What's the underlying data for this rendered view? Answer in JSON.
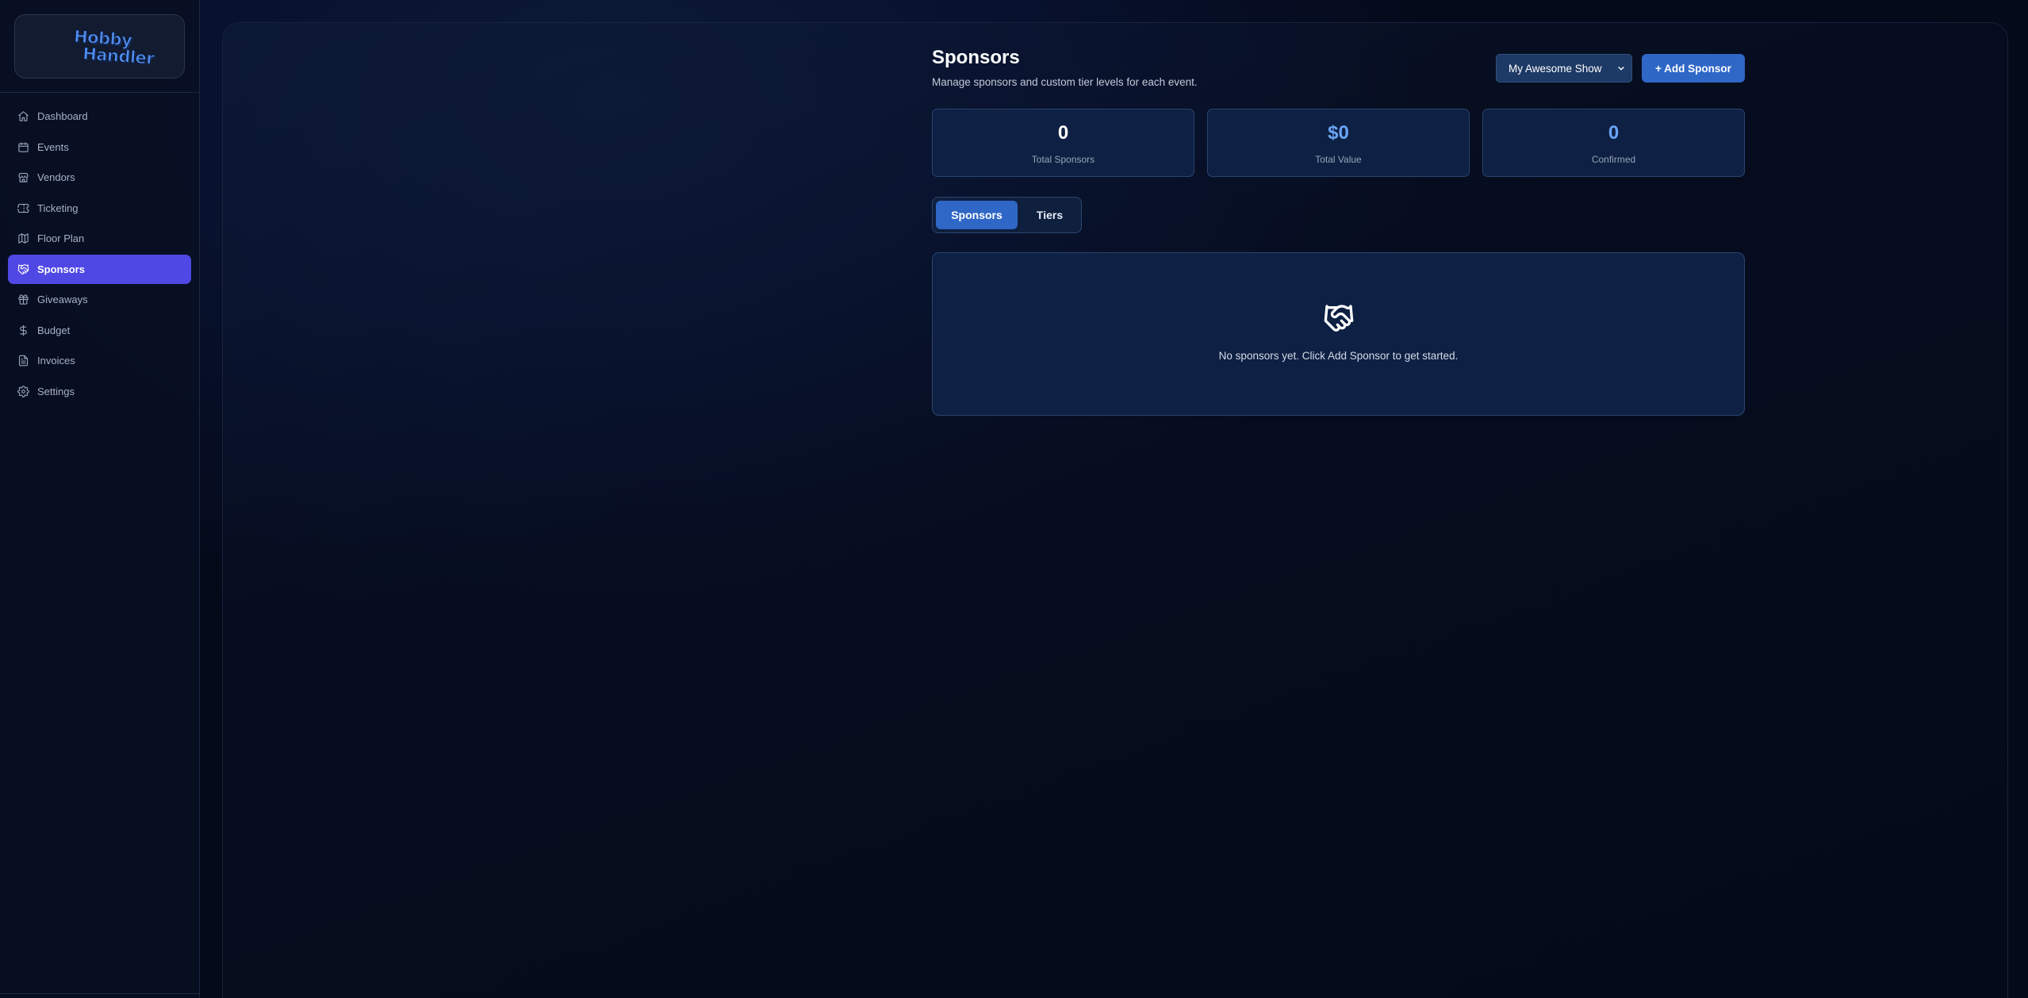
{
  "app": {
    "logo_line1": "Hobby",
    "logo_line2": "Handler"
  },
  "sidebar": {
    "items": [
      {
        "label": "Dashboard",
        "icon": "home-icon"
      },
      {
        "label": "Events",
        "icon": "calendar-icon"
      },
      {
        "label": "Vendors",
        "icon": "store-icon"
      },
      {
        "label": "Ticketing",
        "icon": "ticket-icon"
      },
      {
        "label": "Floor Plan",
        "icon": "map-icon"
      },
      {
        "label": "Sponsors",
        "icon": "handshake-icon",
        "active": true
      },
      {
        "label": "Giveaways",
        "icon": "gift-icon"
      },
      {
        "label": "Budget",
        "icon": "dollar-icon"
      },
      {
        "label": "Invoices",
        "icon": "file-icon"
      },
      {
        "label": "Settings",
        "icon": "gear-icon"
      }
    ]
  },
  "header": {
    "title": "Sponsors",
    "subtitle": "Manage sponsors and custom tier levels for each event.",
    "event_select_value": "My Awesome Show",
    "add_button_label": "+ Add Sponsor"
  },
  "stats": [
    {
      "value": "0",
      "label": "Total Sponsors",
      "color": "#ffffff"
    },
    {
      "value": "$0",
      "label": "Total Value",
      "color": "#6aa5f5"
    },
    {
      "value": "0",
      "label": "Confirmed",
      "color": "#6aa5f5"
    }
  ],
  "tabs": [
    {
      "label": "Sponsors",
      "active": true
    },
    {
      "label": "Tiers",
      "active": false
    }
  ],
  "empty_state": {
    "icon": "handshake-icon",
    "message": "No sponsors yet. Click Add Sponsor to get started."
  },
  "colors": {
    "accent": "#5048e5",
    "primary_button": "#2f67c7",
    "card_bg": "#0e2043"
  }
}
